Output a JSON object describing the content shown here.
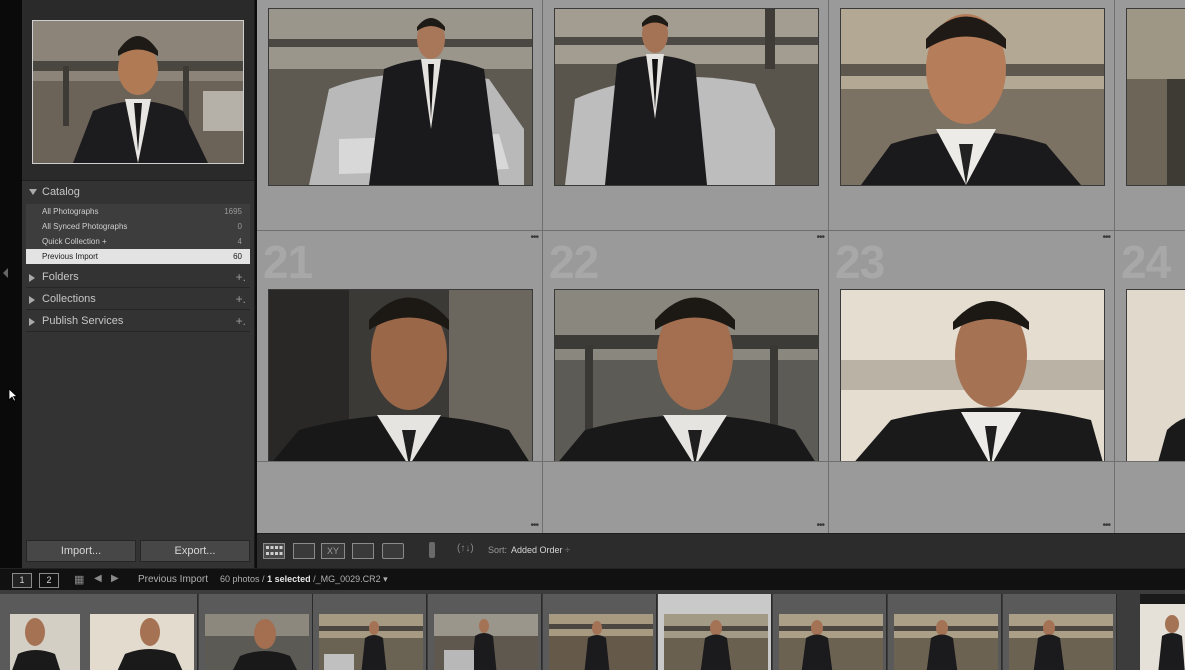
{
  "left_panel": {
    "catalog": {
      "title": "Catalog",
      "items": [
        {
          "label": "All Photographs",
          "count": "1695"
        },
        {
          "label": "All Synced Photographs",
          "count": "0"
        },
        {
          "label": "Quick Collection +",
          "count": "4"
        },
        {
          "label": "Previous Import",
          "count": "60"
        }
      ]
    },
    "folders": {
      "title": "Folders",
      "action": "+."
    },
    "collections": {
      "title": "Collections",
      "action": "+."
    },
    "publish_services": {
      "title": "Publish Services",
      "action": "+."
    },
    "import_button": "Import...",
    "export_button": "Export..."
  },
  "grid": {
    "cells": [
      {
        "number": "",
        "photo": "man-car-buttoning"
      },
      {
        "number": "",
        "photo": "man-car-standing"
      },
      {
        "number": "",
        "photo": "man-closeup-warm"
      },
      {
        "number": "21",
        "photo": "man-closeup-dark"
      },
      {
        "number": "22",
        "photo": "man-closeup-freeway"
      },
      {
        "number": "23",
        "photo": "man-closeup-bright"
      },
      {
        "number": "24",
        "photo": "man-partial"
      }
    ]
  },
  "toolbar": {
    "sort_label": "Sort:",
    "sort_value": "Added Order",
    "sort_arrow": "÷"
  },
  "filmstrip_header": {
    "screen_1": "1",
    "screen_2": "2",
    "source": "Previous Import",
    "photo_count": "60 photos /",
    "selected": "1 selected",
    "filename": "/_MG_0029.CR2",
    "dropdown": "▾"
  },
  "filmstrip": {
    "thumbnails": [
      "t1",
      "t2",
      "t3",
      "t4",
      "t5",
      "t6",
      "t7",
      "t8",
      "t9",
      "t10",
      "t11"
    ],
    "selected_index": 6
  },
  "colors": {
    "panel_bg": "#333333",
    "grid_bg": "#8a8a8a",
    "selected_row": "#e3e3e3"
  }
}
